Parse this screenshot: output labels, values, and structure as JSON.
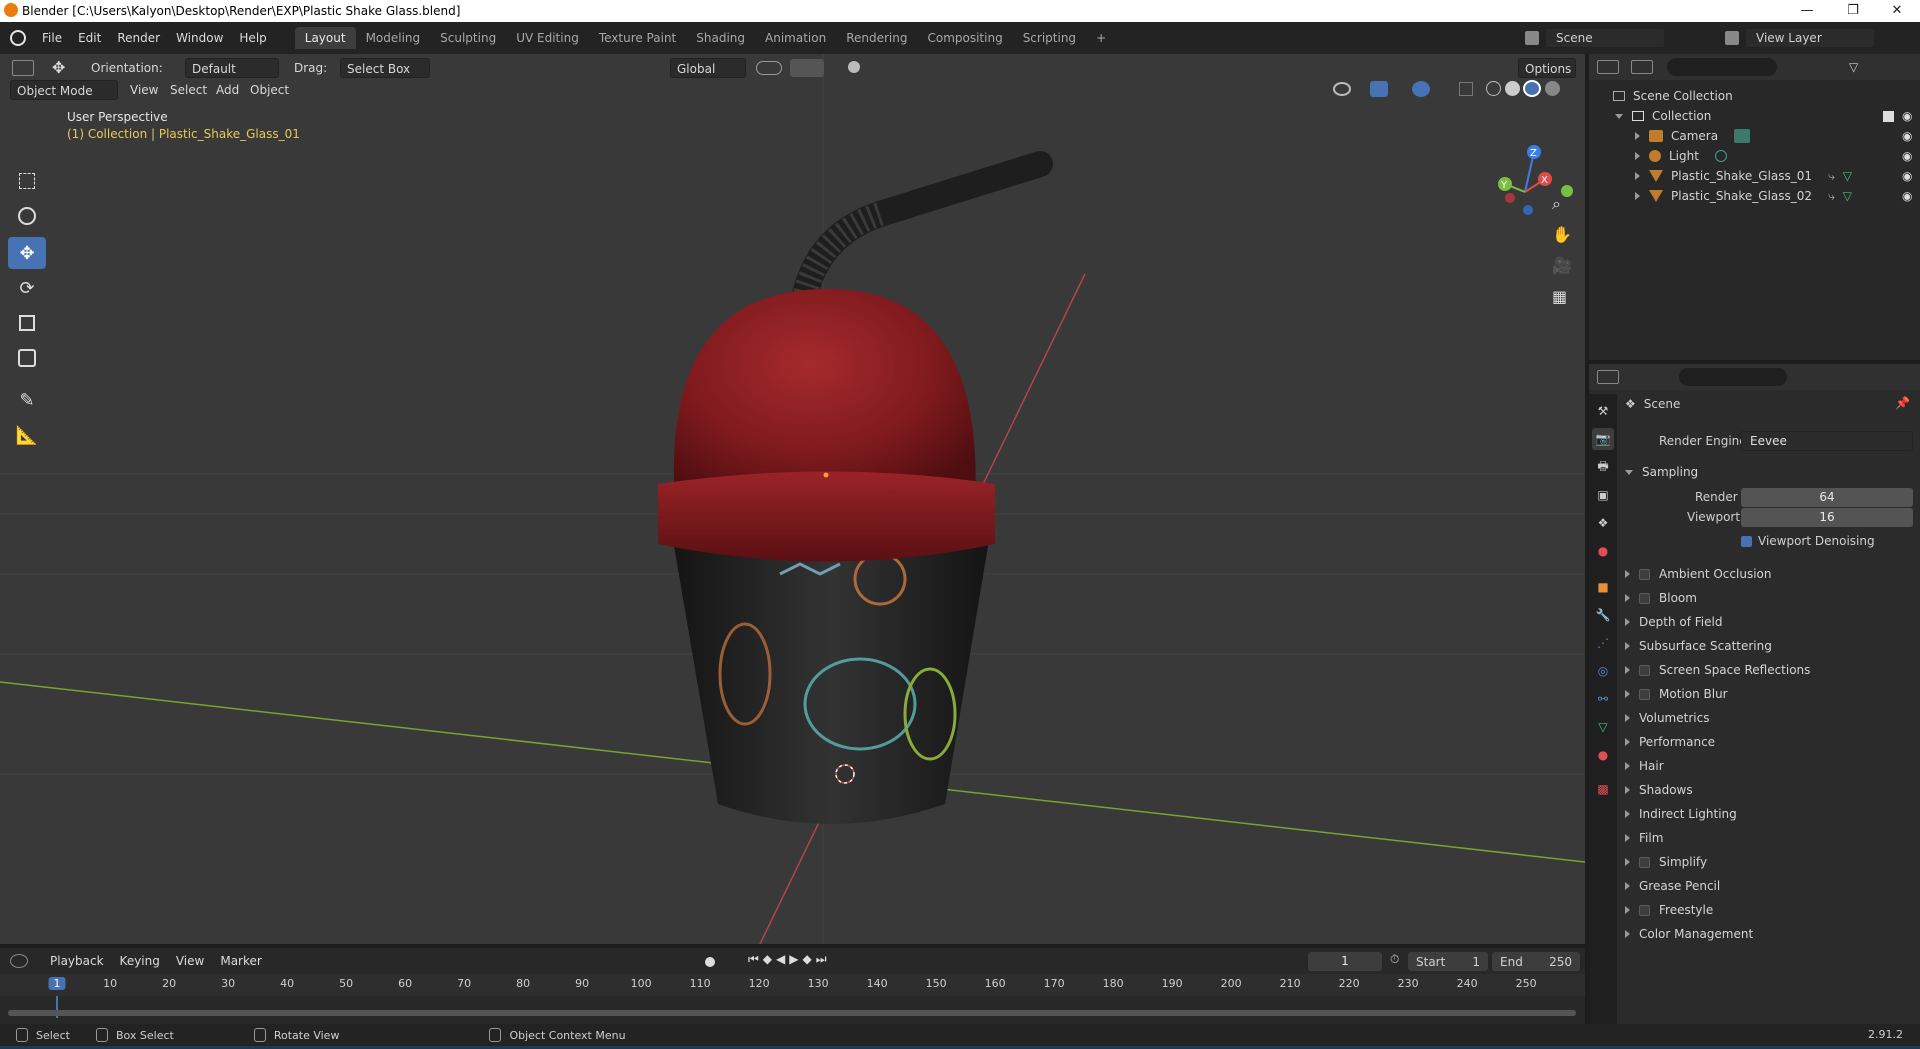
{
  "window": {
    "title": "Blender [C:\\Users\\Kalyon\\Desktop\\Render\\EXP\\Plastic Shake Glass.blend]",
    "minimize": "—",
    "maximize": "❐",
    "close": "✕"
  },
  "menu": [
    "File",
    "Edit",
    "Render",
    "Window",
    "Help"
  ],
  "workspaces": [
    "Layout",
    "Modeling",
    "Sculpting",
    "UV Editing",
    "Texture Paint",
    "Shading",
    "Animation",
    "Rendering",
    "Compositing",
    "Scripting",
    "+"
  ],
  "active_workspace": "Layout",
  "scene": {
    "name": "Scene",
    "view_layer": "View Layer"
  },
  "viewport_header": {
    "orientation_label": "Orientation:",
    "orientation_value": "Default",
    "drag_label": "Drag:",
    "drag_value": "Select Box",
    "transform": "Global",
    "options": "Options",
    "mode": "Object Mode",
    "menus": [
      "View",
      "Select",
      "Add",
      "Object"
    ]
  },
  "viewport": {
    "perspective": "User Perspective",
    "collection_info": "(1) Collection | Plastic_Shake_Glass_01",
    "gizmo": {
      "x": "X",
      "y": "Y",
      "z": "Z"
    }
  },
  "tools": [
    "select-box",
    "cursor",
    "move",
    "rotate",
    "scale",
    "transform",
    "annotate",
    "measure"
  ],
  "outliner": {
    "root": "Scene Collection",
    "collection": "Collection",
    "items": [
      {
        "name": "Camera",
        "icon": "camera-icon"
      },
      {
        "name": "Light",
        "icon": "light-icon"
      },
      {
        "name": "Plastic_Shake_Glass_01",
        "icon": "mesh-icon"
      },
      {
        "name": "Plastic_Shake_Glass_02",
        "icon": "mesh-icon"
      }
    ]
  },
  "properties": {
    "context": "Scene",
    "render_engine_label": "Render Engine",
    "render_engine_value": "Eevee",
    "sampling": {
      "label": "Sampling",
      "render_label": "Render",
      "render_value": "64",
      "viewport_label": "Viewport",
      "viewport_value": "16",
      "denoise_label": "Viewport Denoising"
    },
    "panels": [
      {
        "label": "Ambient Occlusion",
        "checkbox": true
      },
      {
        "label": "Bloom",
        "checkbox": true
      },
      {
        "label": "Depth of Field",
        "checkbox": false
      },
      {
        "label": "Subsurface Scattering",
        "checkbox": false
      },
      {
        "label": "Screen Space Reflections",
        "checkbox": true
      },
      {
        "label": "Motion Blur",
        "checkbox": true
      },
      {
        "label": "Volumetrics",
        "checkbox": false
      },
      {
        "label": "Performance",
        "checkbox": false
      },
      {
        "label": "Hair",
        "checkbox": false
      },
      {
        "label": "Shadows",
        "checkbox": false
      },
      {
        "label": "Indirect Lighting",
        "checkbox": false
      },
      {
        "label": "Film",
        "checkbox": false
      },
      {
        "label": "Simplify",
        "checkbox": true
      },
      {
        "label": "Grease Pencil",
        "checkbox": false
      },
      {
        "label": "Freestyle",
        "checkbox": true
      },
      {
        "label": "Color Management",
        "checkbox": false
      }
    ]
  },
  "timeline": {
    "menus": [
      "Playback",
      "Keying",
      "View",
      "Marker"
    ],
    "current_frame": "1",
    "start_label": "Start",
    "start_value": "1",
    "end_label": "End",
    "end_value": "250",
    "ticks": [
      "1",
      "10",
      "20",
      "30",
      "40",
      "50",
      "60",
      "70",
      "80",
      "90",
      "100",
      "110",
      "120",
      "130",
      "140",
      "150",
      "160",
      "170",
      "180",
      "190",
      "200",
      "210",
      "220",
      "230",
      "240",
      "250"
    ]
  },
  "status": {
    "select": "Select",
    "box_select": "Box Select",
    "rotate_view": "Rotate View",
    "context_menu": "Object Context Menu",
    "version": "2.91.2"
  },
  "colors": {
    "accent": "#4772b3",
    "selected_text": "#e8c85a",
    "lid": "#8a1e22",
    "cup": "#2a2a2a"
  }
}
